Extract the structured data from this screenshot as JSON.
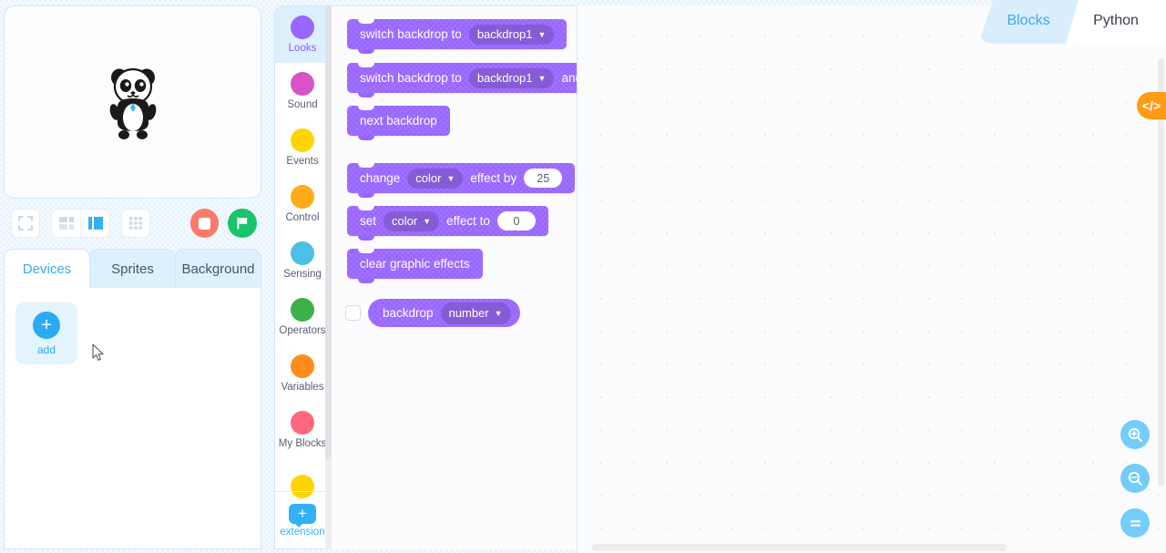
{
  "app": {
    "background_color": "#e8f4fd",
    "accent_color": "#2aaaf3",
    "block_color": "#9966ff"
  },
  "stage": {
    "sprite_name": "panda-sprite"
  },
  "stage_toolbar": {
    "buttons": [
      {
        "name": "fullscreen-button",
        "icon": "fullscreen-icon"
      },
      {
        "name": "small-stage-button",
        "icon": "small-stage-icon"
      },
      {
        "name": "large-stage-button",
        "icon": "large-stage-icon"
      },
      {
        "name": "grid-button",
        "icon": "grid-icon"
      }
    ],
    "stop_label": "stop",
    "start_label": "start"
  },
  "left_tabs": [
    {
      "label": "Devices",
      "active": true
    },
    {
      "label": "Sprites",
      "active": false
    },
    {
      "label": "Background",
      "active": false
    }
  ],
  "devices_panel": {
    "add_label": "add",
    "add_icon": "plus-icon"
  },
  "categories": [
    {
      "label": "Looks",
      "color": "#9966ff",
      "selected": true
    },
    {
      "label": "Sound",
      "color": "#d653c8",
      "selected": false
    },
    {
      "label": "Events",
      "color": "#ffd500",
      "selected": false
    },
    {
      "label": "Control",
      "color": "#ffab19",
      "selected": false
    },
    {
      "label": "Sensing",
      "color": "#4cbfe6",
      "selected": false
    },
    {
      "label": "Operators",
      "color": "#3eb049",
      "selected": false
    },
    {
      "label": "Variables",
      "color": "#ff8c1a",
      "selected": false
    },
    {
      "label": "My Blocks",
      "color": "#ff6680",
      "selected": false
    },
    {
      "label": "",
      "color": "#ffd500",
      "selected": false
    }
  ],
  "extension": {
    "label": "extension",
    "icon": "add-extension-icon"
  },
  "palette": {
    "blocks": [
      {
        "name": "switch-backdrop-to-block",
        "parts": [
          {
            "type": "text",
            "value": "switch backdrop to"
          },
          {
            "type": "dropdown",
            "value": "backdrop1"
          }
        ]
      },
      {
        "name": "switch-backdrop-to-and-wait-block",
        "parts": [
          {
            "type": "text",
            "value": "switch backdrop to"
          },
          {
            "type": "dropdown",
            "value": "backdrop1"
          },
          {
            "type": "text",
            "value": "and"
          }
        ]
      },
      {
        "name": "next-backdrop-block",
        "parts": [
          {
            "type": "text",
            "value": "next backdrop"
          }
        ]
      },
      {
        "name": "change-effect-by-block",
        "parts": [
          {
            "type": "text",
            "value": "change"
          },
          {
            "type": "dropdown",
            "value": "color"
          },
          {
            "type": "text",
            "value": "effect by"
          },
          {
            "type": "number",
            "value": "25"
          }
        ]
      },
      {
        "name": "set-effect-to-block",
        "parts": [
          {
            "type": "text",
            "value": "set"
          },
          {
            "type": "dropdown",
            "value": "color"
          },
          {
            "type": "text",
            "value": "effect to"
          },
          {
            "type": "number",
            "value": "0"
          }
        ]
      },
      {
        "name": "clear-graphic-effects-block",
        "parts": [
          {
            "type": "text",
            "value": "clear graphic effects"
          }
        ]
      }
    ],
    "monitor_block": {
      "name": "backdrop-reporter-block",
      "label": "backdrop",
      "dropdown": "number",
      "checked": false
    }
  },
  "top_tabs": [
    {
      "label": "Blocks",
      "active": true
    },
    {
      "label": "Python",
      "active": false
    }
  ],
  "code_tab": {
    "label": "</>",
    "icon": "code-icon"
  },
  "zoom_controls": [
    {
      "name": "zoom-in-button",
      "icon": "zoom-in-icon",
      "label": "+"
    },
    {
      "name": "zoom-out-button",
      "icon": "zoom-out-icon",
      "label": "−"
    },
    {
      "name": "zoom-reset-button",
      "icon": "zoom-reset-icon",
      "label": "="
    }
  ]
}
